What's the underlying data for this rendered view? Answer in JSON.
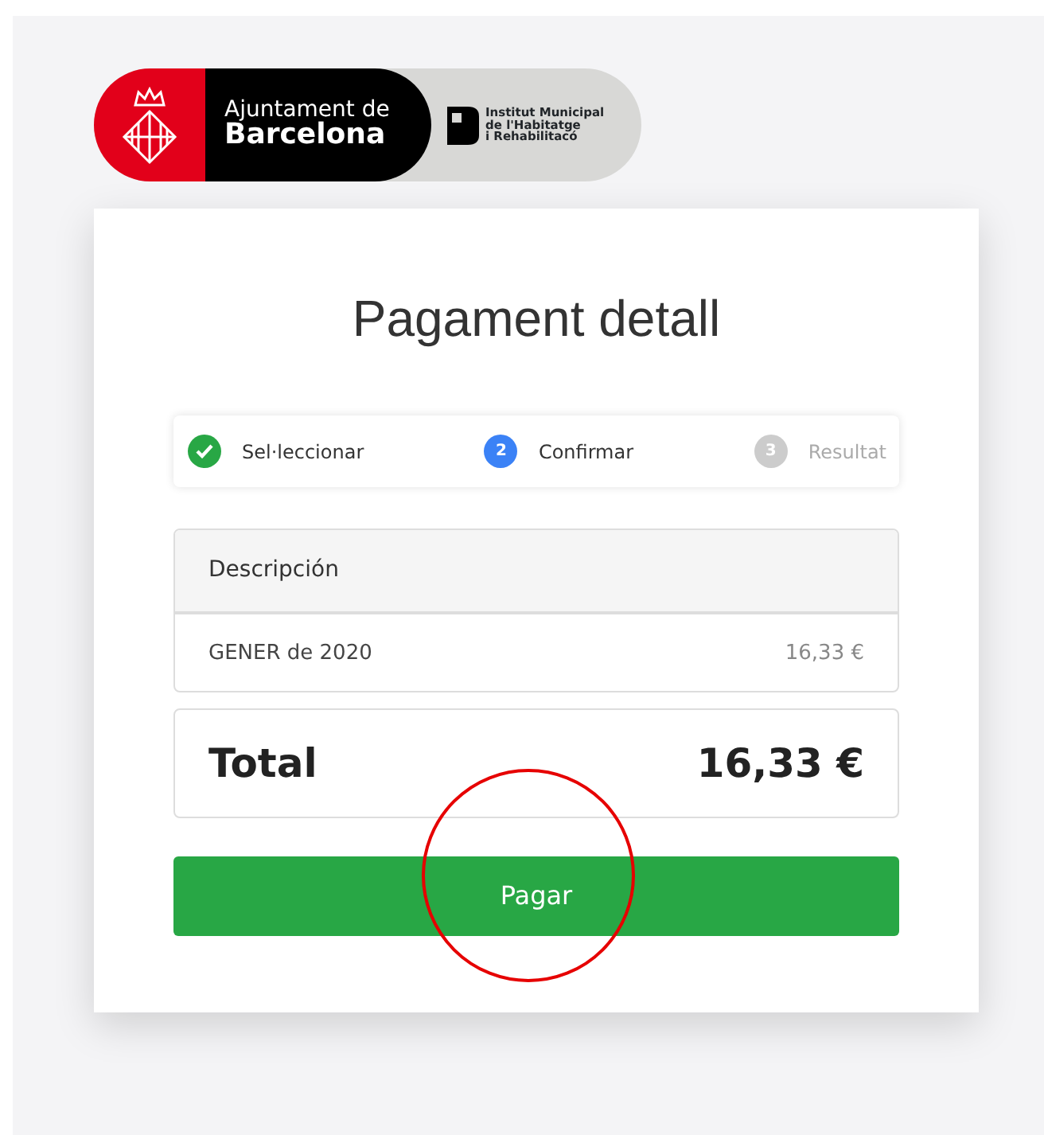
{
  "logo": {
    "primary_line1": "Ajuntament de",
    "primary_line2": "Barcelona",
    "secondary_lines": [
      "Institut Municipal",
      "de l'Habitatge",
      "i Rehabilitacó"
    ]
  },
  "title": "Pagament detall",
  "steps": [
    {
      "kind": "done",
      "label": "Sel·leccionar"
    },
    {
      "kind": "current",
      "number": "2",
      "label": "Confirmar"
    },
    {
      "kind": "pending",
      "number": "3",
      "label": "Resultat"
    }
  ],
  "table": {
    "header": "Descripción",
    "rows": [
      {
        "description": "GENER de 2020",
        "amount": "16,33 €"
      }
    ]
  },
  "total": {
    "label": "Total",
    "amount": "16,33 €"
  },
  "button": "Pagar"
}
